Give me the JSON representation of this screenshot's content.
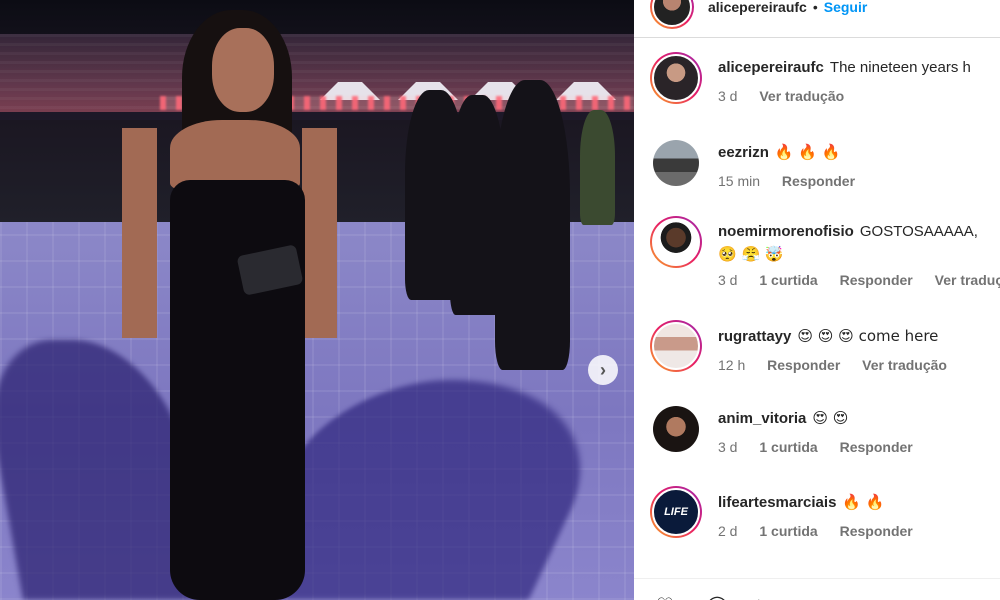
{
  "post": {
    "author": "alicepereiraufc",
    "dot": "•",
    "follow_label": "Seguir",
    "next_icon": "chevron-right-icon"
  },
  "comments": [
    {
      "username": "alicepereiraufc",
      "text": "The nineteen years h",
      "text2": "",
      "time": "3 d",
      "likes": "",
      "reply": "",
      "translate": "Ver tradução"
    },
    {
      "username": "eezrizn",
      "text": "🔥 🔥 🔥",
      "text2": "",
      "time": "15 min",
      "likes": "",
      "reply": "Responder",
      "translate": ""
    },
    {
      "username": "noemirmorenofisio",
      "text": "GOSTOSAAAAA,",
      "text2": "🥺 😤 🤯",
      "time": "3 d",
      "likes": "1 curtida",
      "reply": "Responder",
      "translate": "Ver tradução"
    },
    {
      "username": "rugrattayy",
      "text": "😍 😍 😍 come here",
      "text2": "",
      "time": "12 h",
      "likes": "",
      "reply": "Responder",
      "translate": "Ver tradução"
    },
    {
      "username": "anim_vitoria",
      "text": "😍 😍",
      "text2": "",
      "time": "3 d",
      "likes": "1 curtida",
      "reply": "Responder",
      "translate": ""
    },
    {
      "username": "lifeartesmarciais",
      "text": "🔥 🔥",
      "text2": "",
      "time": "2 d",
      "likes": "1 curtida",
      "reply": "Responder",
      "translate": ""
    }
  ],
  "colors": {
    "follow_blue": "#0095f6",
    "meta_gray": "#737373",
    "text_dark": "#262626",
    "story_ring": "#e91e63"
  }
}
